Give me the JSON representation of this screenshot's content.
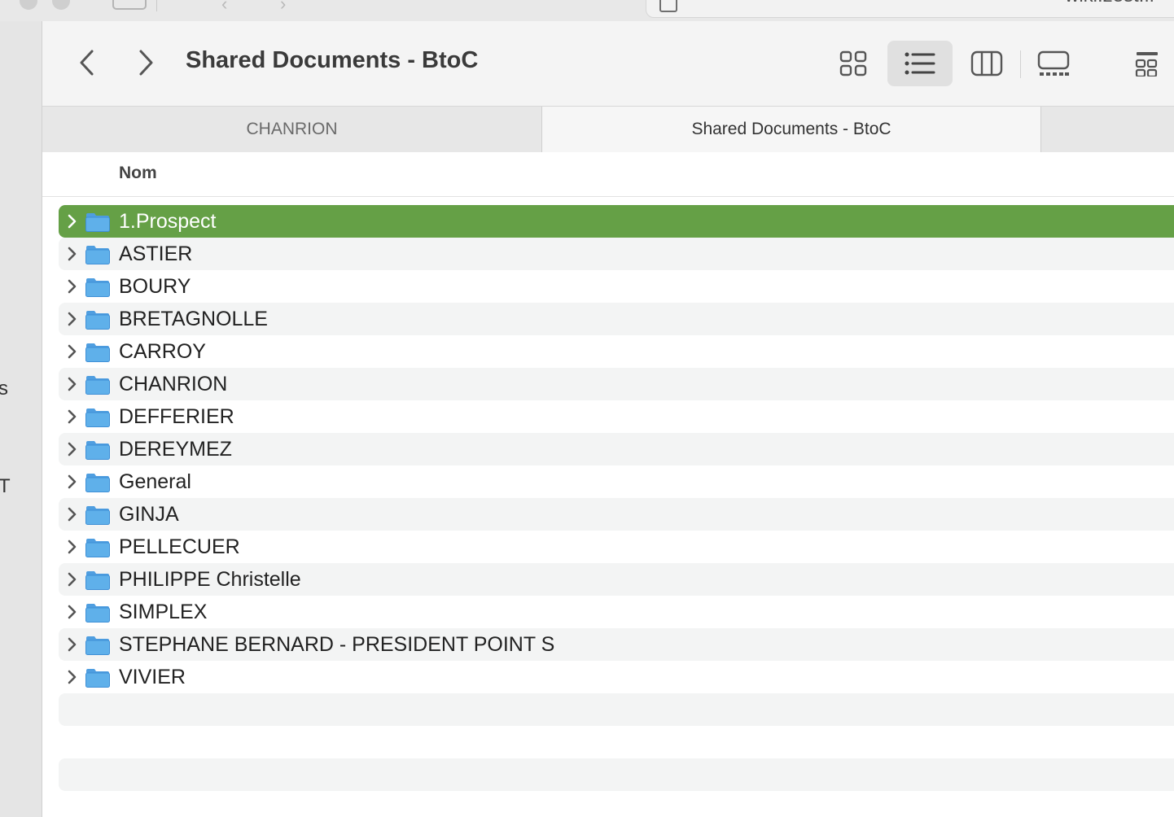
{
  "browser": {
    "address_text": "wiki.zest.fr"
  },
  "sidebar": {
    "fragments": [
      "s",
      "T"
    ]
  },
  "toolbar": {
    "title": "Shared Documents - BtoC",
    "back_icon": "chevron-left-icon",
    "forward_icon": "chevron-right-icon",
    "views": [
      {
        "icon": "icon-view-icon",
        "active": false
      },
      {
        "icon": "list-view-icon",
        "active": true
      },
      {
        "icon": "column-view-icon",
        "active": false
      },
      {
        "icon": "gallery-view-icon",
        "active": false
      }
    ]
  },
  "tabs": [
    {
      "label": "CHANRION",
      "active": false
    },
    {
      "label": "Shared Documents - BtoC",
      "active": true
    }
  ],
  "columns": {
    "name": "Nom"
  },
  "colors": {
    "selection": "#65a046",
    "folder": "#5fb0ea"
  },
  "items": [
    {
      "label": "1.Prospect",
      "selected": true
    },
    {
      "label": "ASTIER",
      "selected": false
    },
    {
      "label": "BOURY",
      "selected": false
    },
    {
      "label": "BRETAGNOLLE",
      "selected": false
    },
    {
      "label": "CARROY",
      "selected": false
    },
    {
      "label": "CHANRION",
      "selected": false
    },
    {
      "label": "DEFFERIER",
      "selected": false
    },
    {
      "label": "DEREYMEZ",
      "selected": false
    },
    {
      "label": "General",
      "selected": false
    },
    {
      "label": "GINJA",
      "selected": false
    },
    {
      "label": "PELLECUER",
      "selected": false
    },
    {
      "label": "PHILIPPE Christelle",
      "selected": false
    },
    {
      "label": "SIMPLEX",
      "selected": false
    },
    {
      "label": "STEPHANE BERNARD - PRESIDENT POINT S",
      "selected": false
    },
    {
      "label": "VIVIER",
      "selected": false
    }
  ]
}
